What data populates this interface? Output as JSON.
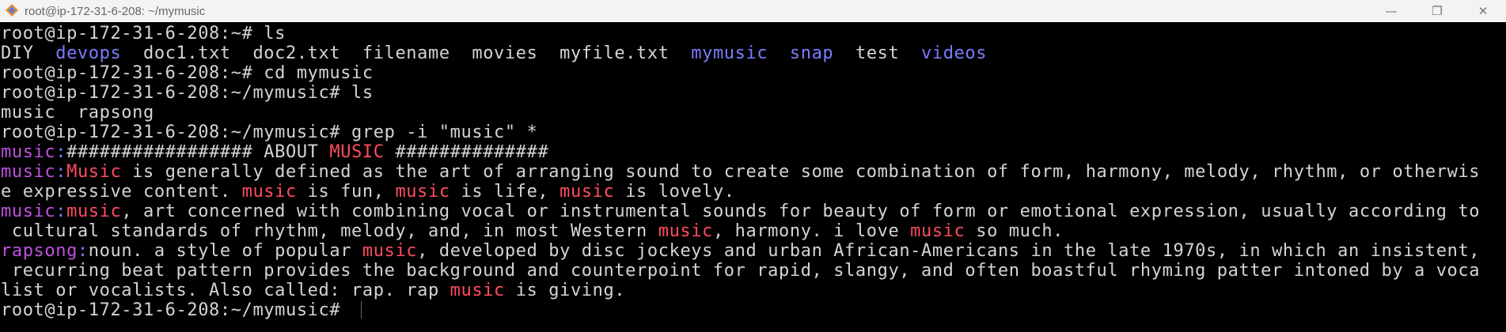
{
  "window": {
    "title": "root@ip-172-31-6-208: ~/mymusic",
    "icon": "putty-icon",
    "controls": [
      "minimize-icon",
      "maximize-icon",
      "close-icon"
    ]
  },
  "colors": {
    "background": "#000000",
    "text": "#d4d4d4",
    "directory": "#7b7bff",
    "filename_match": "#c050e0",
    "match_highlight": "#ff4c5e"
  },
  "terminal": {
    "lines": [
      [
        {
          "t": "root@ip-172-31-6-208:~# ls",
          "s": ""
        }
      ],
      [
        {
          "t": "DIY  ",
          "s": ""
        },
        {
          "t": "devops",
          "s": "blue"
        },
        {
          "t": "  doc1.txt  doc2.txt  filename  movies  myfile.txt  ",
          "s": ""
        },
        {
          "t": "mymusic",
          "s": "blue"
        },
        {
          "t": "  ",
          "s": ""
        },
        {
          "t": "snap",
          "s": "blue"
        },
        {
          "t": "  test  ",
          "s": ""
        },
        {
          "t": "videos",
          "s": "blue"
        }
      ],
      [
        {
          "t": "root@ip-172-31-6-208:~# cd mymusic",
          "s": ""
        }
      ],
      [
        {
          "t": "root@ip-172-31-6-208:~/mymusic# ls",
          "s": ""
        }
      ],
      [
        {
          "t": "music  rapsong",
          "s": ""
        }
      ],
      [
        {
          "t": "root@ip-172-31-6-208:~/mymusic# grep -i \"music\" *",
          "s": ""
        }
      ],
      [
        {
          "t": "music",
          "s": "mag"
        },
        {
          "t": ":",
          "s": "blue"
        },
        {
          "t": "################# ABOUT ",
          "s": ""
        },
        {
          "t": "MUSIC",
          "s": "red"
        },
        {
          "t": " ##############",
          "s": ""
        }
      ],
      [
        {
          "t": "music",
          "s": "mag"
        },
        {
          "t": ":",
          "s": "blue"
        },
        {
          "t": "Music",
          "s": "red"
        },
        {
          "t": " is generally defined as the art of arranging sound to create some combination of form, harmony, melody, rhythm, or otherwis",
          "s": ""
        }
      ],
      [
        {
          "t": "e expressive content. ",
          "s": ""
        },
        {
          "t": "music",
          "s": "red"
        },
        {
          "t": " is fun, ",
          "s": ""
        },
        {
          "t": "music",
          "s": "red"
        },
        {
          "t": " is life, ",
          "s": ""
        },
        {
          "t": "music",
          "s": "red"
        },
        {
          "t": " is lovely.",
          "s": ""
        }
      ],
      [
        {
          "t": "music",
          "s": "mag"
        },
        {
          "t": ":",
          "s": "blue"
        },
        {
          "t": "music",
          "s": "red"
        },
        {
          "t": ", art concerned with combining vocal or instrumental sounds for beauty of form or emotional expression, usually according to",
          "s": ""
        }
      ],
      [
        {
          "t": " cultural standards of rhythm, melody, and, in most Western ",
          "s": ""
        },
        {
          "t": "music",
          "s": "red"
        },
        {
          "t": ", harmony. i love ",
          "s": ""
        },
        {
          "t": "music",
          "s": "red"
        },
        {
          "t": " so much.",
          "s": ""
        }
      ],
      [
        {
          "t": "rapsong",
          "s": "mag"
        },
        {
          "t": ":",
          "s": "blue"
        },
        {
          "t": "noun. a style of popular ",
          "s": ""
        },
        {
          "t": "music",
          "s": "red"
        },
        {
          "t": ", developed by disc jockeys and urban African-Americans in the late 1970s, in which an insistent,",
          "s": ""
        }
      ],
      [
        {
          "t": " recurring beat pattern provides the background and counterpoint for rapid, slangy, and often boastful rhyming patter intoned by a voca",
          "s": ""
        }
      ],
      [
        {
          "t": "list or vocalists. Also called: rap. rap ",
          "s": ""
        },
        {
          "t": "music",
          "s": "red"
        },
        {
          "t": " is giving.",
          "s": ""
        }
      ],
      [
        {
          "t": "root@ip-172-31-6-208:~/mymusic# ",
          "s": ""
        }
      ]
    ]
  }
}
